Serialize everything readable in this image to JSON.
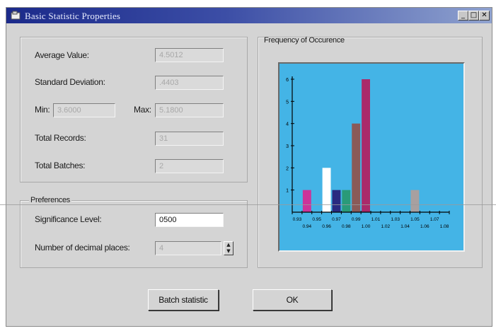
{
  "window": {
    "title": "Basic Statistic Properties",
    "minimize_glyph": "_",
    "maximize_glyph": "□",
    "close_glyph": "✕"
  },
  "stats": {
    "average_label": "Average Value:",
    "average_value": "4.5012",
    "std_label": "Standard Deviation:",
    "std_value": ".4403",
    "min_label": "Min:",
    "min_value": "3.6000",
    "max_label": "Max:",
    "max_value": "5.1800",
    "records_label": "Total Records:",
    "records_value": "31",
    "batches_label": "Total Batches:",
    "batches_value": "2"
  },
  "preferences": {
    "group_label": "Preferences",
    "significance_label": "Significance Level:",
    "significance_value": "0500",
    "decimals_label": "Number of decimal places:",
    "decimals_value": "4"
  },
  "buttons": {
    "batch_label": "Batch statistic",
    "ok_label": "OK"
  },
  "chart_data": {
    "type": "bar",
    "title": "Frequency of Occurence",
    "categories": [
      "0.93",
      "0.94",
      "0.95",
      "0.96",
      "0.97",
      "0.98",
      "0.99",
      "1.00",
      "1.01",
      "1.02",
      "1.03",
      "1.04",
      "1.05",
      "1.06",
      "1.07",
      "1.08"
    ],
    "tick_labels_row1": [
      "0.93",
      "0.95",
      "0.97",
      "0.99",
      "1.01",
      "1.03",
      "1.05",
      "1.07"
    ],
    "tick_labels_row2": [
      "0.94",
      "0.96",
      "0.98",
      "1.00",
      "1.02",
      "1.04",
      "1.06",
      "1.08"
    ],
    "values": [
      0,
      1,
      0,
      2,
      1,
      1,
      4,
      6,
      0,
      0,
      0,
      0,
      1,
      0,
      0,
      0
    ],
    "bar_colors": [
      "#cc3399",
      "#cc3399",
      "#ffffff",
      "#ffffff",
      "#2a2a80",
      "#2a9a78",
      "#8a5a58",
      "#aa2a6a",
      "#44b4e6",
      "#44b4e6",
      "#44b4e6",
      "#44b4e6",
      "#a8a0a0",
      "#44b4e6",
      "#44b4e6",
      "#44b4e6"
    ],
    "ylim": [
      0,
      6
    ],
    "yticks": [
      "1",
      "2",
      "3",
      "4",
      "5",
      "6"
    ],
    "y_values": [
      1,
      2,
      3,
      4,
      5,
      6
    ],
    "grid": false,
    "background": "#44b4e6"
  }
}
